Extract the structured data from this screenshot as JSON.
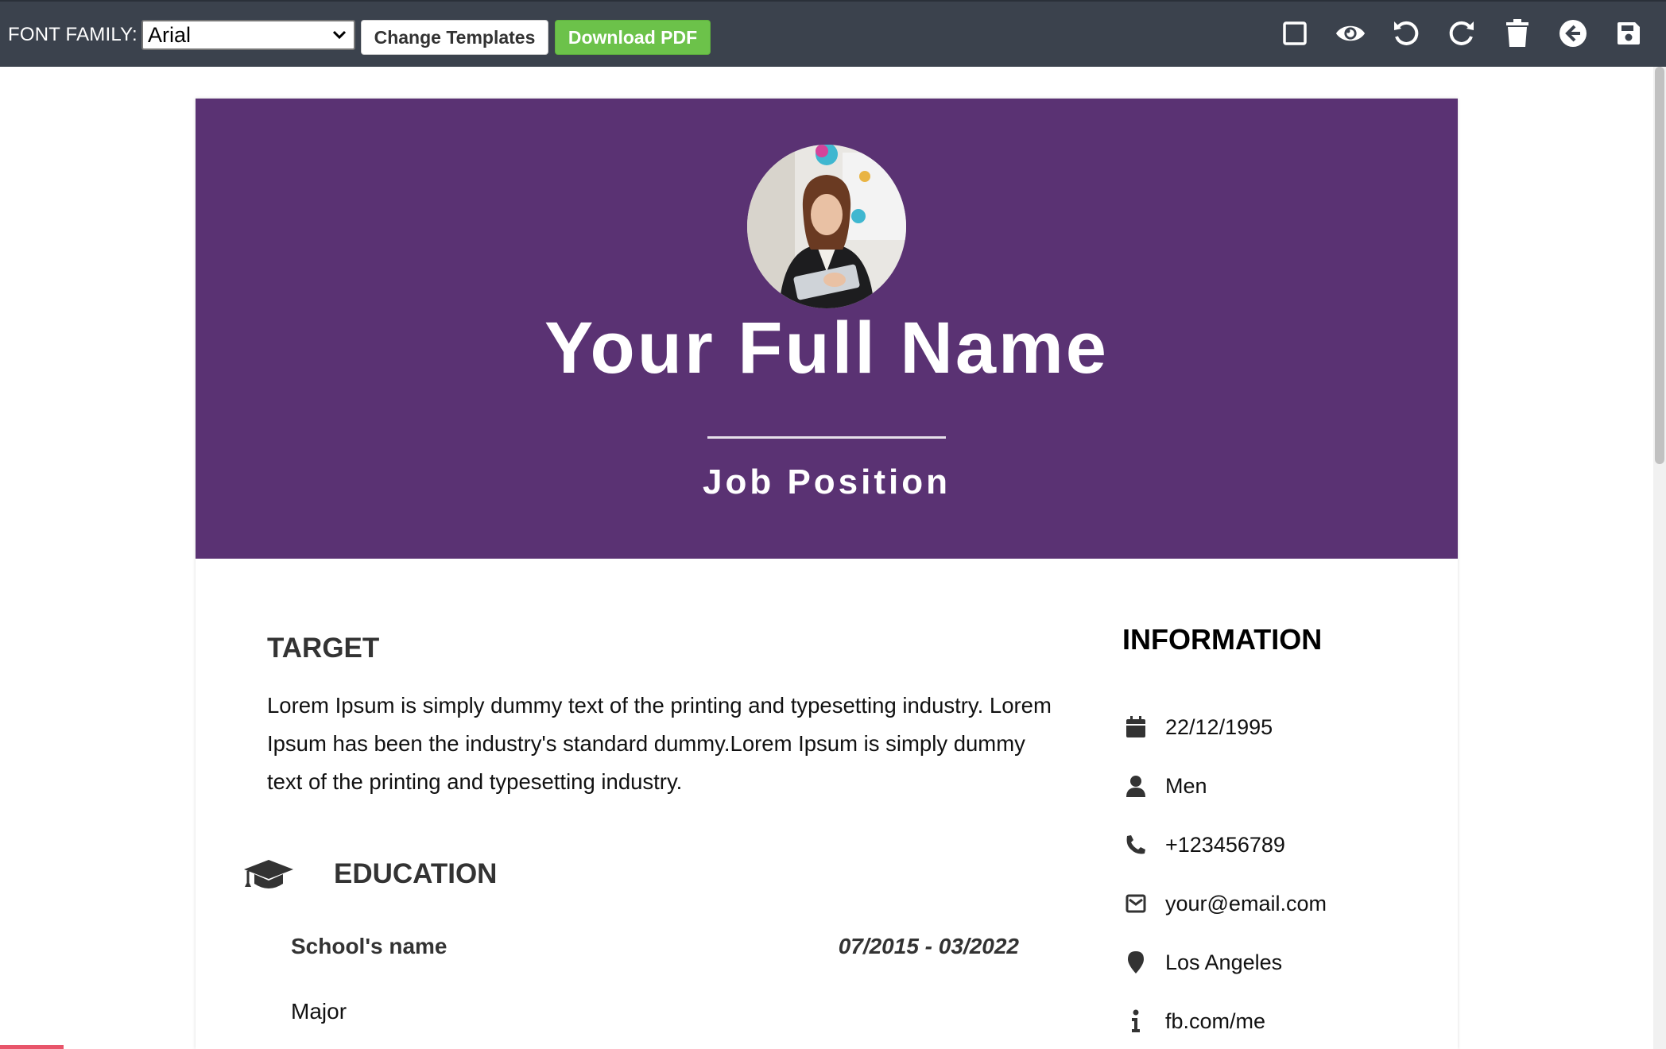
{
  "toolbar": {
    "font_family_label": "FONT FAMILY:",
    "font_family_value": "Arial",
    "change_templates_label": "Change Templates",
    "download_pdf_label": "Download PDF",
    "icons": [
      "square-icon",
      "eye-icon",
      "undo-icon",
      "redo-icon",
      "trash-icon",
      "back-arrow-icon",
      "save-icon"
    ]
  },
  "resume": {
    "header_color": "#5a3273",
    "full_name": "Your Full Name",
    "job_position": "Job Position",
    "target": {
      "title": "TARGET",
      "text": "Lorem Ipsum is simply dummy text of the printing and typesetting industry. Lorem Ipsum has been the industry's standard dummy.Lorem Ipsum is simply dummy text of the printing and typesetting industry."
    },
    "education": {
      "title": "EDUCATION",
      "school": "School's name",
      "dates": "07/2015 - 03/2022",
      "major": "Major"
    },
    "information": {
      "title": "INFORMATION",
      "items": [
        {
          "icon": "calendar-icon",
          "value": "22/12/1995"
        },
        {
          "icon": "user-icon",
          "value": "Men"
        },
        {
          "icon": "phone-icon",
          "value": "+123456789"
        },
        {
          "icon": "envelope-icon",
          "value": "your@email.com"
        },
        {
          "icon": "map-marker-icon",
          "value": "Los Angeles"
        },
        {
          "icon": "info-icon",
          "value": "fb.com/me"
        }
      ]
    }
  }
}
